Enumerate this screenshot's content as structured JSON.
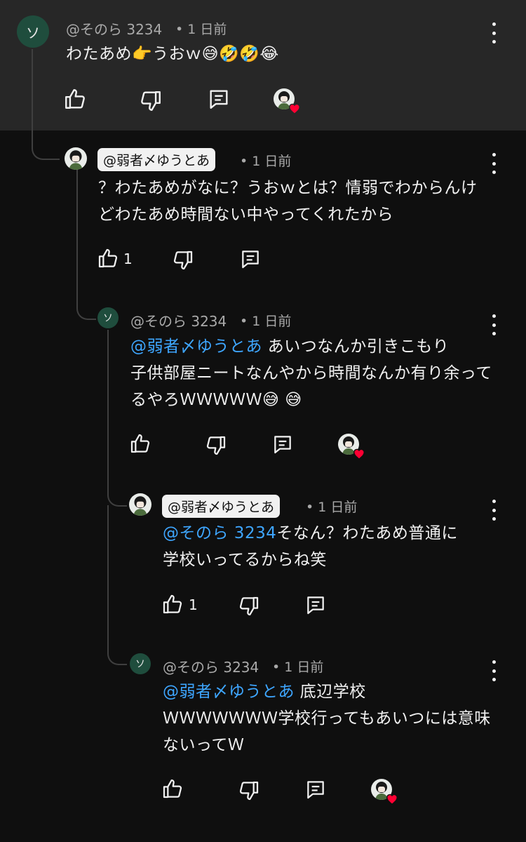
{
  "comments": [
    {
      "avatar_letter": "ソ",
      "author": "@そのら 3234",
      "time": "• 1 日前",
      "text": "わたあめ👉うおｗ😅🤣🤣😂",
      "like_count": ""
    },
    {
      "author": "@弱者〆ゆうとあ",
      "time": "• 1 日前",
      "text": "？わたあめがなに？うおｗとは？情弱でわからんけどわたあめ時間ない中やってくれたから",
      "like_count": "1"
    },
    {
      "avatar_letter": "ソ",
      "author": "@そのら 3234",
      "time": "• 1 日前",
      "mention": "@弱者〆ゆうとあ",
      "text_line1": " あいつなんか引きこもり",
      "text_rest": "子供部屋ニートなんやから時間なんか有り余ってるやろＷＷＷＷＷ😅 😅",
      "like_count": ""
    },
    {
      "author": "@弱者〆ゆうとあ",
      "time": "• 1 日前",
      "mention": "@そのら 3234",
      "text_line1": "そなん？わたあめ普通に",
      "text_rest": "学校いってるからね笑",
      "like_count": "1"
    },
    {
      "avatar_letter": "ソ",
      "author": "@そのら 3234",
      "time": "• 1 日前",
      "mention": "@弱者〆ゆうとあ",
      "text_line1": " 底辺学校",
      "text_rest": "ＷＷＷＷＷＷＷ学校行ってもあいつには意味ないってＷ",
      "like_count": ""
    }
  ],
  "icons": {
    "like": "thumbs-up-icon",
    "dislike": "thumbs-down-icon",
    "reply": "reply-icon",
    "more": "more-vertical-icon",
    "creator_heart": "creator-heart-icon"
  },
  "colors": {
    "background": "#0f0f0f",
    "highlight_band": "#272727",
    "mention": "#3ea6ff",
    "heart": "#ff0033"
  }
}
